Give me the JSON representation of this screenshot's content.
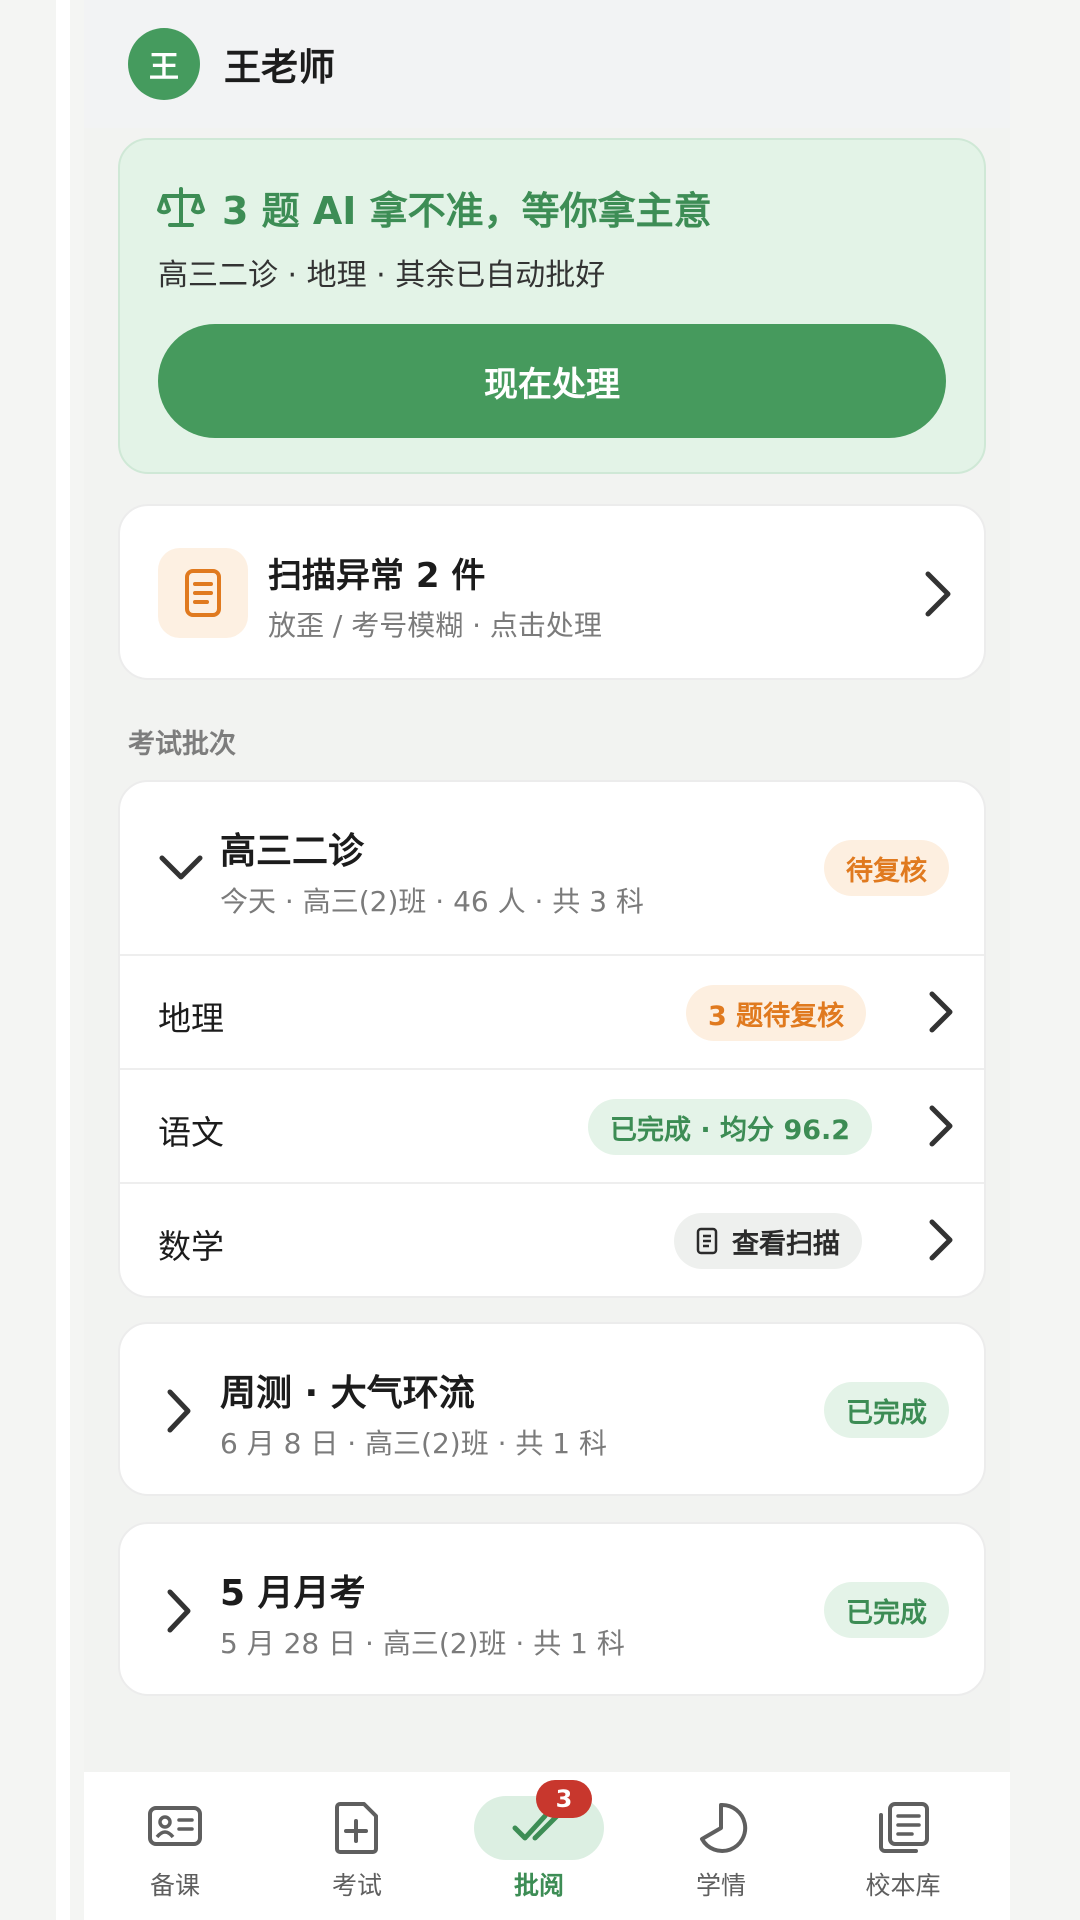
{
  "header": {
    "avatar_text": "王",
    "user_name": "王老师"
  },
  "ai_banner": {
    "title": "3 题 AI 拿不准，等你拿主意",
    "subtitle": "高三二诊 · 地理 · 其余已自动批好",
    "button_label": "现在处理",
    "icon": "scale-icon"
  },
  "scan_alert": {
    "title": "扫描异常 2 件",
    "subtitle": "放歪 / 考号模糊 · 点击处理",
    "icon": "document-icon"
  },
  "section_label": "考试批次",
  "exam_group": {
    "title": "高三二诊",
    "subtitle": "今天 · 高三(2)班 · 46 人 · 共 3 科",
    "status": "待复核",
    "subjects": [
      {
        "name": "地理",
        "badge": "3 题待复核",
        "badge_type": "orange"
      },
      {
        "name": "语文",
        "badge": "已完成 · 均分 96.2",
        "badge_type": "green"
      },
      {
        "name": "数学",
        "badge": "查看扫描",
        "badge_type": "gray"
      }
    ]
  },
  "other_exams": [
    {
      "title": "周测 · 大气环流",
      "subtitle": "6 月 8 日 · 高三(2)班 · 共 1 科",
      "status": "已完成"
    },
    {
      "title": "5 月月考",
      "subtitle": "5 月 28 日 · 高三(2)班 · 共 1 科",
      "status": "已完成"
    }
  ],
  "bottom_nav": {
    "items": [
      {
        "label": "备课",
        "icon": "id-card-icon"
      },
      {
        "label": "考试",
        "icon": "add-file-icon"
      },
      {
        "label": "批阅",
        "icon": "double-check-icon",
        "badge": "3",
        "active": true
      },
      {
        "label": "学情",
        "icon": "pie-chart-icon"
      },
      {
        "label": "校本库",
        "icon": "library-icon"
      }
    ]
  },
  "colors": {
    "brand_green": "#469a5d",
    "warning_orange": "#e07a1f",
    "badge_red": "#c8372d"
  }
}
